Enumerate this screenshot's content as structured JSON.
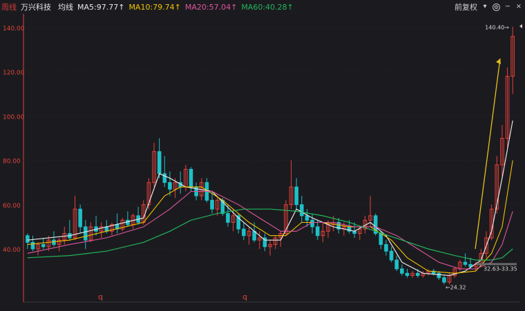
{
  "header": {
    "title": "周线",
    "stock_name": "万兴科技",
    "avg_label": "均线",
    "ma": [
      {
        "label": "MA5:97.77↑",
        "color": "#e8e8e8"
      },
      {
        "label": "MA10:79.74↑",
        "color": "#f2c200"
      },
      {
        "label": "MA20:57.04↑",
        "color": "#e0559e"
      },
      {
        "label": "MA60:40.28↑",
        "color": "#22b45a"
      }
    ],
    "adjust_label": "前复权",
    "icons": [
      "adjust-dropdown-icon",
      "settings-icon",
      "minus-icon",
      "close-icon"
    ]
  },
  "chart_data": {
    "type": "candlestick",
    "y_axis_ticks": [
      "140.00",
      "120.00",
      "100.00",
      "80.00",
      "60.00",
      "40.00"
    ],
    "ylim": [
      24,
      142
    ],
    "grid": true,
    "annotations": {
      "high": "140.40",
      "low": "24.32",
      "range": "32.63-33.35",
      "markers": [
        "q",
        "q"
      ]
    },
    "colors": {
      "up": "#e8403a",
      "down": "#1fbfc7",
      "bg": "#1b1b1f",
      "axis": "#e0443b",
      "arrow": "#e8c21a"
    },
    "candles": [
      [
        46,
        47,
        40,
        43
      ],
      [
        43,
        46,
        39,
        40
      ],
      [
        40,
        43,
        37,
        42
      ],
      [
        42,
        45,
        40,
        41
      ],
      [
        41,
        46,
        39,
        44
      ],
      [
        44,
        48,
        41,
        42
      ],
      [
        42,
        45,
        39,
        44
      ],
      [
        44,
        50,
        42,
        47
      ],
      [
        47,
        53,
        44,
        45
      ],
      [
        45,
        64,
        44,
        58
      ],
      [
        58,
        60,
        47,
        50
      ],
      [
        50,
        53,
        40,
        44
      ],
      [
        44,
        52,
        43,
        50
      ],
      [
        50,
        55,
        46,
        48
      ],
      [
        48,
        52,
        45,
        50
      ],
      [
        50,
        53,
        47,
        48
      ],
      [
        48,
        52,
        46,
        51
      ],
      [
        51,
        56,
        47,
        49
      ],
      [
        49,
        54,
        48,
        53
      ],
      [
        53,
        57,
        50,
        51
      ],
      [
        51,
        56,
        49,
        55
      ],
      [
        55,
        59,
        51,
        52
      ],
      [
        52,
        62,
        51,
        60
      ],
      [
        60,
        72,
        58,
        70
      ],
      [
        70,
        88,
        68,
        84
      ],
      [
        84,
        90,
        72,
        74
      ],
      [
        74,
        82,
        68,
        70
      ],
      [
        70,
        75,
        64,
        67
      ],
      [
        67,
        72,
        63,
        70
      ],
      [
        70,
        75,
        65,
        68
      ],
      [
        68,
        78,
        66,
        76
      ],
      [
        76,
        77,
        66,
        68
      ],
      [
        68,
        70,
        62,
        64
      ],
      [
        64,
        72,
        62,
        70
      ],
      [
        70,
        72,
        61,
        62
      ],
      [
        62,
        66,
        56,
        58
      ],
      [
        58,
        64,
        55,
        62
      ],
      [
        62,
        63,
        55,
        56
      ],
      [
        56,
        60,
        50,
        52
      ],
      [
        52,
        58,
        48,
        55
      ],
      [
        55,
        56,
        47,
        49
      ],
      [
        49,
        52,
        44,
        46
      ],
      [
        46,
        50,
        42,
        48
      ],
      [
        48,
        52,
        43,
        44
      ],
      [
        44,
        48,
        40,
        45
      ],
      [
        45,
        47,
        39,
        41
      ],
      [
        41,
        44,
        37,
        42
      ],
      [
        42,
        46,
        40,
        45
      ],
      [
        45,
        48,
        41,
        47
      ],
      [
        47,
        62,
        46,
        60
      ],
      [
        60,
        80,
        58,
        68
      ],
      [
        68,
        72,
        58,
        60
      ],
      [
        60,
        64,
        52,
        55
      ],
      [
        55,
        58,
        50,
        53
      ],
      [
        53,
        56,
        47,
        50
      ],
      [
        50,
        53,
        44,
        46
      ],
      [
        46,
        52,
        43,
        48
      ],
      [
        48,
        53,
        45,
        51
      ],
      [
        51,
        55,
        48,
        52
      ],
      [
        52,
        54,
        47,
        49
      ],
      [
        49,
        52,
        46,
        50
      ],
      [
        50,
        53,
        47,
        48
      ],
      [
        48,
        52,
        45,
        47
      ],
      [
        47,
        50,
        44,
        49
      ],
      [
        49,
        55,
        47,
        53
      ],
      [
        53,
        64,
        50,
        55
      ],
      [
        55,
        56,
        46,
        47
      ],
      [
        47,
        48,
        40,
        42
      ],
      [
        42,
        44,
        37,
        39
      ],
      [
        39,
        41,
        34,
        35
      ],
      [
        35,
        37,
        30,
        31
      ],
      [
        31,
        33,
        28,
        29
      ],
      [
        29,
        31,
        27,
        28
      ],
      [
        28,
        30,
        27,
        29
      ],
      [
        29,
        31,
        27,
        28
      ],
      [
        28,
        30,
        27,
        29
      ],
      [
        29,
        31,
        28,
        30
      ],
      [
        30,
        31,
        28,
        29
      ],
      [
        29,
        30,
        26,
        27
      ],
      [
        27,
        28,
        24,
        25
      ],
      [
        25,
        29,
        24,
        28
      ],
      [
        28,
        32,
        27,
        31
      ],
      [
        31,
        35,
        30,
        34
      ],
      [
        34,
        38,
        32,
        33
      ],
      [
        33,
        36,
        31,
        32
      ],
      [
        32,
        34,
        30,
        33
      ],
      [
        33,
        40,
        32,
        38
      ],
      [
        38,
        48,
        36,
        45
      ],
      [
        45,
        60,
        44,
        58
      ],
      [
        58,
        82,
        56,
        78
      ],
      [
        78,
        96,
        72,
        90
      ],
      [
        90,
        122,
        86,
        118
      ],
      [
        118,
        140.4,
        110,
        136
      ]
    ],
    "ma_lines": [
      {
        "name": "MA5",
        "color": "#e8e8e8",
        "width": 1.2,
        "points": [
          [
            0,
            44
          ],
          [
            8,
            46
          ],
          [
            15,
            50
          ],
          [
            22,
            54
          ],
          [
            25,
            74
          ],
          [
            27,
            72
          ],
          [
            30,
            68
          ],
          [
            35,
            66
          ],
          [
            40,
            54
          ],
          [
            45,
            44
          ],
          [
            48,
            44
          ],
          [
            51,
            58
          ],
          [
            54,
            54
          ],
          [
            58,
            50
          ],
          [
            62,
            48
          ],
          [
            65,
            52
          ],
          [
            68,
            46
          ],
          [
            71,
            34
          ],
          [
            75,
            29
          ],
          [
            80,
            28
          ],
          [
            83,
            30
          ],
          [
            86,
            35
          ],
          [
            88,
            48
          ],
          [
            90,
            72
          ],
          [
            92,
            98
          ]
        ]
      },
      {
        "name": "MA10",
        "color": "#f2c200",
        "width": 1.1,
        "points": [
          [
            0,
            42
          ],
          [
            8,
            44
          ],
          [
            15,
            48
          ],
          [
            22,
            52
          ],
          [
            26,
            64
          ],
          [
            29,
            68
          ],
          [
            33,
            68
          ],
          [
            37,
            62
          ],
          [
            42,
            52
          ],
          [
            46,
            46
          ],
          [
            49,
            46
          ],
          [
            52,
            52
          ],
          [
            56,
            52
          ],
          [
            61,
            50
          ],
          [
            65,
            50
          ],
          [
            69,
            44
          ],
          [
            72,
            36
          ],
          [
            76,
            30
          ],
          [
            81,
            29
          ],
          [
            85,
            30
          ],
          [
            88,
            38
          ],
          [
            90,
            50
          ],
          [
            92,
            80
          ]
        ]
      },
      {
        "name": "MA20",
        "color": "#e0559e",
        "width": 1.1,
        "points": [
          [
            0,
            38
          ],
          [
            8,
            42
          ],
          [
            15,
            45
          ],
          [
            22,
            50
          ],
          [
            27,
            58
          ],
          [
            31,
            66
          ],
          [
            35,
            66
          ],
          [
            40,
            60
          ],
          [
            44,
            54
          ],
          [
            48,
            48
          ],
          [
            51,
            48
          ],
          [
            54,
            52
          ],
          [
            58,
            52
          ],
          [
            62,
            50
          ],
          [
            66,
            50
          ],
          [
            70,
            46
          ],
          [
            74,
            40
          ],
          [
            78,
            34
          ],
          [
            82,
            31
          ],
          [
            85,
            31
          ],
          [
            88,
            34
          ],
          [
            90,
            42
          ],
          [
            92,
            57
          ]
        ]
      },
      {
        "name": "MA60",
        "color": "#22b45a",
        "width": 1.2,
        "points": [
          [
            0,
            36
          ],
          [
            8,
            37
          ],
          [
            15,
            39
          ],
          [
            22,
            43
          ],
          [
            27,
            48
          ],
          [
            31,
            53
          ],
          [
            36,
            56
          ],
          [
            41,
            58
          ],
          [
            46,
            58
          ],
          [
            51,
            57
          ],
          [
            56,
            55
          ],
          [
            61,
            52
          ],
          [
            66,
            48
          ],
          [
            71,
            44
          ],
          [
            76,
            40
          ],
          [
            81,
            37
          ],
          [
            85,
            35
          ],
          [
            88,
            35
          ],
          [
            90,
            36
          ],
          [
            92,
            40
          ]
        ]
      }
    ]
  }
}
